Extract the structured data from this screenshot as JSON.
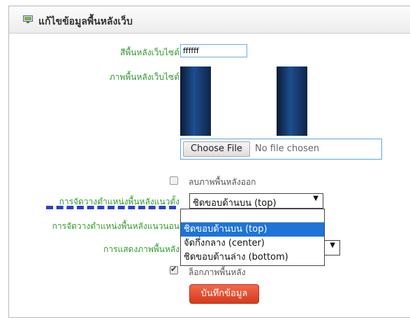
{
  "header": {
    "title": "แก้ไขข้อมูลพื้นหลังเว็บ"
  },
  "form": {
    "bg_color_label": "สีพื้นหลังเว็บไซต์",
    "bg_color_value": "ffffff",
    "bg_image_label": "ภาพพื้นหลังเว็บไซต์",
    "file_button_label": "Choose File",
    "file_status": "No file chosen",
    "remove_image_label": "ลบภาพพื้นหลังออก",
    "remove_image_checked": false,
    "vertical_position_label": "การจัดวางตำแหน่งพื้นหลังแนวตั้ง",
    "vertical_position_value": "ชิดขอบด้านบน (top)",
    "horizontal_position_label": "การจัดวางตำแหน่งพื้นหลังแนวนอน",
    "display_label": "การแสดงภาพพื้นหลัง",
    "lock_image_label": "ล็อกภาพพื้นหลัง",
    "lock_image_checked": true,
    "save_label": "บันทึกข้อมูล"
  },
  "dropdown_options": [
    {
      "label": "ชิดขอบด้านบน (top)",
      "selected": true
    },
    {
      "label": "จัดกึ่งกลาง (center)",
      "selected": false
    },
    {
      "label": "ชิดขอบด้านล่าง (bottom)",
      "selected": false
    }
  ],
  "colors": {
    "label_green": "#2e9b2e",
    "highlight_blue": "#1e74d8",
    "dash_blue": "#2a3fd0",
    "save_red": "#d8391b"
  }
}
